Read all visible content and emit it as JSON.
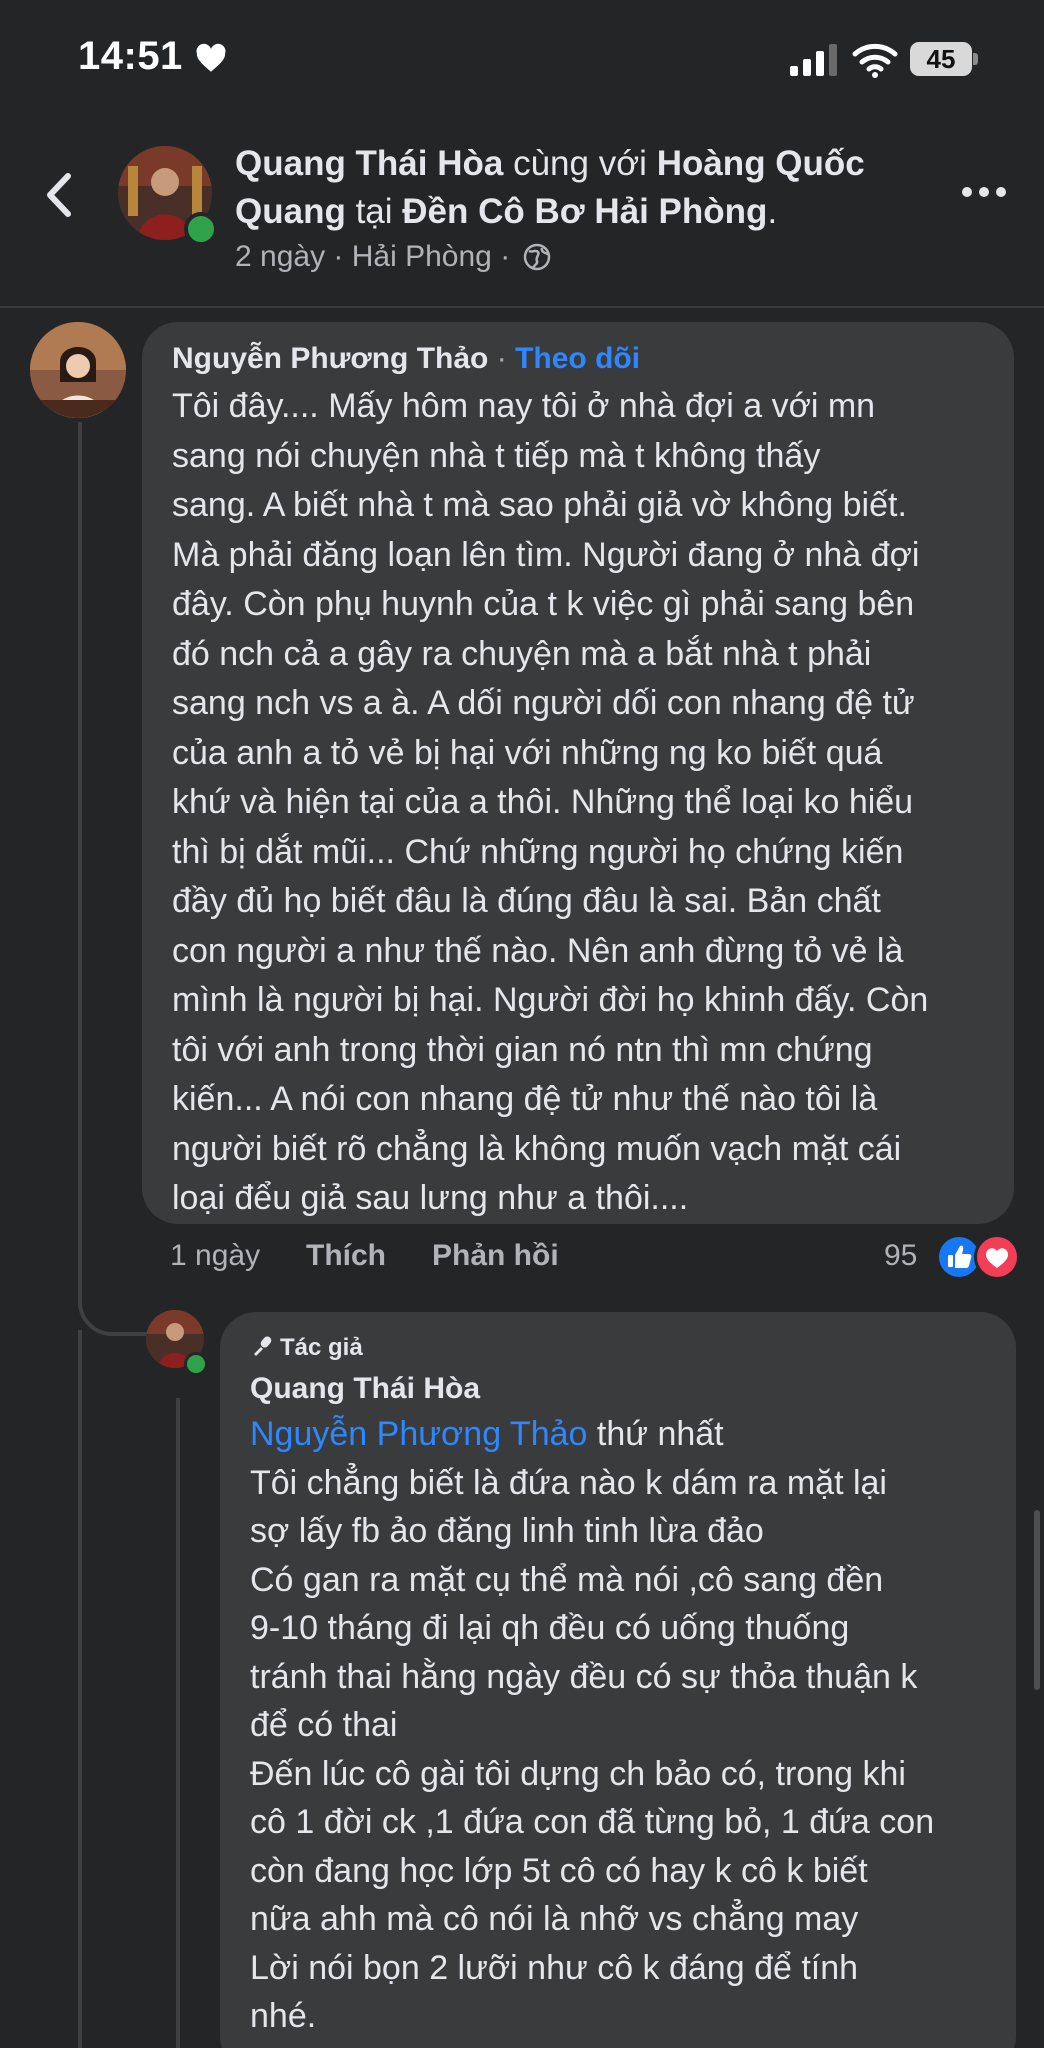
{
  "status_bar": {
    "time": "14:51",
    "battery": "45"
  },
  "header": {
    "author": "Quang Thái Hòa",
    "with_word": "cùng với",
    "tagged": "Hoàng Quốc Quang",
    "at_word": "tại",
    "place": "Đền Cô Bơ Hải Phòng",
    "period": ".",
    "time": "2 ngày",
    "location": "Hải Phòng",
    "separator": "·"
  },
  "comment1": {
    "name": "Nguyễn Phương Thảo",
    "dot": "·",
    "follow_label": "Theo dõi",
    "text": "Tôi đây.... Mấy hôm nay tôi ở nhà đợi a với mn\nsang nói chuyện nhà t tiếp mà t không thấy\nsang. A biết nhà t mà sao phải giả vờ không biết.\nMà phải đăng loạn lên tìm. Người đang ở nhà đợi\nđây. Còn phụ huynh của t k việc gì phải sang bên\nđó nch cả a gây ra chuyện mà a bắt nhà t phải\nsang nch vs a à. A dối người dối con nhang đệ tử\ncủa anh a tỏ vẻ bị hại với những ng ko biết quá\nkhứ và hiện tại của a thôi. Những thể loại ko hiểu\nthì bị dắt mũi... Chứ những người họ chứng kiến\nđầy đủ họ biết đâu là đúng đâu là sai. Bản chất\ncon người a như thế nào. Nên anh đừng tỏ vẻ là\nmình là người bị hại. Người đời họ khinh đấy. Còn\ntôi với anh trong thời gian nó ntn thì mn chứng\nkiến... A nói con nhang đệ tử như thế nào tôi là\nngười biết rõ chẳng là không muốn vạch mặt cái\nloại đểu giả sau lưng như a thôi....",
    "time": "1 ngày",
    "like_label": "Thích",
    "reply_label": "Phản hồi",
    "reaction_count": "95"
  },
  "comment2": {
    "badge": "Tác giả",
    "name": "Quang Thái Hòa",
    "mention": "Nguyễn Phương Thảo",
    "mention_suffix": " thứ nhất",
    "text": "Tôi chẳng biết là đứa nào k dám ra mặt lại\nsợ lấy fb ảo đăng linh tinh lừa đảo\nCó gan ra mặt cụ thể mà nói ,cô sang đền\n9-10 tháng đi lại qh đều có uống thuống\ntránh thai hằng ngày đều có sự thỏa thuận k\nđể có thai\nĐến lúc cô gài tôi dựng ch bảo có, trong khi\ncô 1 đời ck ,1 đứa con đã từng bỏ, 1 đứa con\ncòn đang học lớp 5t cô có hay k cô k biết\nnữa ahh mà cô nói là nhỡ vs chẳng may\nLời nói bọn 2 lưỡi như cô k đáng để tính\nnhé."
  },
  "colors": {
    "background": "#242526",
    "bubble": "#3a3b3c",
    "link": "#2d88ff",
    "secondary_text": "#b0b3b8",
    "online": "#31a24c"
  },
  "icons": [
    "heart-icon",
    "signal-icon",
    "wifi-icon",
    "battery-icon",
    "back-icon",
    "more-icon",
    "globe-icon",
    "like-reaction-icon",
    "love-reaction-icon",
    "microphone-icon"
  ]
}
